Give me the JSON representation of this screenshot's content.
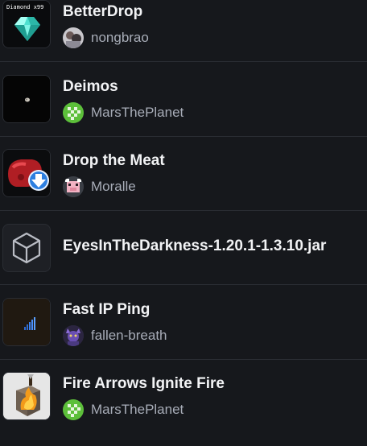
{
  "mods": [
    {
      "title": "BetterDrop",
      "icon": "diamond-icon",
      "icon_label": "Diamond x99",
      "author": "nongbrao",
      "avatar": "photo-avatar"
    },
    {
      "title": "Deimos",
      "icon": "moon-icon",
      "author": "MarsThePlanet",
      "avatar": "green-checker-avatar"
    },
    {
      "title": "Drop the Meat",
      "icon": "meat-drop-icon",
      "author": "Moralle",
      "avatar": "pig-avatar"
    },
    {
      "title": "EyesInTheDarkness-1.20.1-1.3.10.jar",
      "icon": "cube-outline-icon",
      "author": "",
      "avatar": ""
    },
    {
      "title": "Fast IP Ping",
      "icon": "signal-bars-icon",
      "author": "fallen-breath",
      "avatar": "character-avatar"
    },
    {
      "title": "Fire Arrows Ignite Fire",
      "icon": "burning-block-icon",
      "author": "MarsThePlanet",
      "avatar": "green-checker-avatar"
    }
  ],
  "colors": {
    "background": "#16181c",
    "divider": "#2a2d33",
    "title": "#f2f3f5",
    "author": "#a8adb8",
    "green_avatar": "#5cbf3a"
  }
}
